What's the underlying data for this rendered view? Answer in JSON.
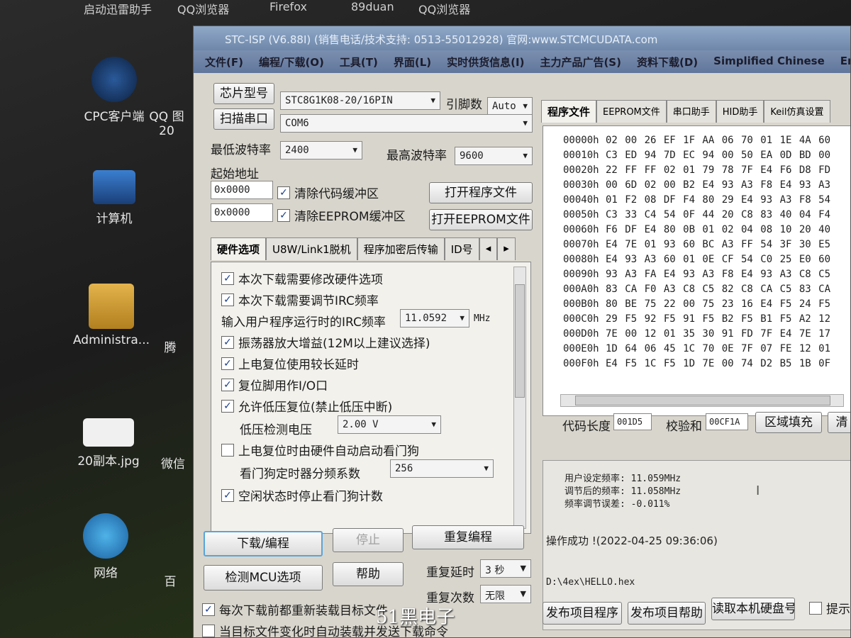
{
  "desktop": {
    "top_labels": [
      "启动迅雷助手",
      "QQ浏览器",
      "Firefox",
      "89duan",
      "QQ浏览器"
    ],
    "icons": [
      {
        "name": "cpc-client",
        "label": "CPC客户端"
      },
      {
        "name": "qq-image",
        "label": "QQ 图20"
      },
      {
        "name": "computer",
        "label": "计算机"
      },
      {
        "name": "administrator",
        "label": "Administra..."
      },
      {
        "name": "image-file",
        "label": "20副本.jpg"
      },
      {
        "name": "wechat",
        "label": "微信"
      },
      {
        "name": "network",
        "label": "网络"
      },
      {
        "name": "baidu",
        "label": "百"
      },
      {
        "name": "tencent",
        "label": "腾"
      }
    ]
  },
  "window": {
    "title": "STC-ISP (V6.88I) (销售电话/技术支持: 0513-55012928) 官网:www.STCMCUDATA.com",
    "menu": [
      "文件(F)",
      "编程/下载(O)",
      "工具(T)",
      "界面(L)",
      "实时供货信息(I)",
      "主力产品广告(S)",
      "资料下载(D)",
      "Simplified Chinese",
      "Eng"
    ]
  },
  "left": {
    "chip_button": "芯片型号",
    "chip_value": "STC8G1K08-20/16PIN",
    "pins_label": "引脚数",
    "pins_value": "Auto",
    "scan_button": "扫描串口",
    "port_value": "COM6",
    "min_baud_label": "最低波特率",
    "min_baud_value": "2400",
    "max_baud_label": "最高波特率",
    "max_baud_value": "9600",
    "start_addr_label": "起始地址",
    "code_addr": "0x0000",
    "clear_code_label": "清除代码缓冲区",
    "open_prog_button": "打开程序文件",
    "eeprom_addr": "0x0000",
    "clear_eeprom_label": "清除EEPROM缓冲区",
    "open_eeprom_button": "打开EEPROM文件",
    "tabs": [
      "硬件选项",
      "U8W/Link1脱机",
      "程序加密后传输",
      "ID号"
    ],
    "options": {
      "opt1": "本次下载需要修改硬件选项",
      "opt2": "本次下载需要调节IRC频率",
      "irc_label": "输入用户程序运行时的IRC频率",
      "irc_value": "11.0592",
      "irc_unit": "MHz",
      "opt3": "振荡器放大增益(12M以上建议选择)",
      "opt4": "上电复位使用较长延时",
      "opt5": "复位脚用作I/O口",
      "opt6": "允许低压复位(禁止低压中断)",
      "lvd_label": "低压检测电压",
      "lvd_value": "2.00 V",
      "opt7": "上电复位时由硬件自动启动看门狗",
      "wdt_label": "看门狗定时器分频系数",
      "wdt_value": "256",
      "opt8": "空闲状态时停止看门狗计数"
    },
    "download_button": "下载/编程",
    "stop_button": "停止",
    "reprogram_button": "重复编程",
    "check_mcu_button": "检测MCU选项",
    "help_button": "帮助",
    "repeat_delay_label": "重复延时",
    "repeat_delay_value": "3 秒",
    "repeat_count_label": "重复次数",
    "repeat_count_value": "无限",
    "reload_label": "每次下载前都重新装载目标文件",
    "auto_load_label": "当目标文件变化时自动装载并发送下载命令"
  },
  "right": {
    "tabs": [
      "程序文件",
      "EEPROM文件",
      "串口助手",
      "HID助手",
      "Keil仿真设置"
    ],
    "hex_rows": [
      {
        "addr": "00000h",
        "bytes": "02 00 26 EF 1F AA 06 70 01 1E 4A 60"
      },
      {
        "addr": "00010h",
        "bytes": "C3 ED 94 7D EC 94 00 50 EA 0D BD 00"
      },
      {
        "addr": "00020h",
        "bytes": "22 FF FF 02 01 79 78 7F E4 F6 D8 FD"
      },
      {
        "addr": "00030h",
        "bytes": "00 6D 02 00 B2 E4 93 A3 F8 E4 93 A3"
      },
      {
        "addr": "00040h",
        "bytes": "01 F2 08 DF F4 80 29 E4 93 A3 F8 54"
      },
      {
        "addr": "00050h",
        "bytes": "C3 33 C4 54 0F 44 20 C8 83 40 04 F4"
      },
      {
        "addr": "00060h",
        "bytes": "F6 DF E4 80 0B 01 02 04 08 10 20 40"
      },
      {
        "addr": "00070h",
        "bytes": "E4 7E 01 93 60 BC A3 FF 54 3F 30 E5"
      },
      {
        "addr": "00080h",
        "bytes": "E4 93 A3 60 01 0E CF 54 C0 25 E0 60"
      },
      {
        "addr": "00090h",
        "bytes": "93 A3 FA E4 93 A3 F8 E4 93 A3 C8 C5"
      },
      {
        "addr": "000A0h",
        "bytes": "83 CA F0 A3 C8 C5 82 C8 CA C5 83 CA"
      },
      {
        "addr": "000B0h",
        "bytes": "80 BE 75 22 00 75 23 16 E4 F5 24 F5"
      },
      {
        "addr": "000C0h",
        "bytes": "29 F5 92 F5 91 F5 B2 F5 B1 F5 A2 12"
      },
      {
        "addr": "000D0h",
        "bytes": "7E 00 12 01 35 30 91 FD 7F E4 7E 17"
      },
      {
        "addr": "000E0h",
        "bytes": "1D 64 06 45 1C 70 0E 7F 07 FE 12 01"
      },
      {
        "addr": "000F0h",
        "bytes": "E4 F5 1C F5 1D 7E 00 74 D2 B5 1B 0F"
      }
    ],
    "code_len_label": "代码长度",
    "code_len_value": "001D5",
    "checksum_label": "校验和",
    "checksum_value": "00CF1A",
    "fill_button": "区域填充",
    "clear_button": "清",
    "status_line1": "用户设定频率: 11.059MHz",
    "status_line2": "调节后的频率: 11.058MHz",
    "status_line3": "频率调节误差: -0.011%",
    "status_result": "操作成功 !(2022-04-25 09:36:06)",
    "file_path": "D:\\4ex\\HELLO.hex",
    "publish_prog_button": "发布项目程序",
    "publish_help_button": "发布项目帮助",
    "read_disk_button": "读取本机硬盘号",
    "hint_label": "提示音"
  },
  "watermark": "51黑电子"
}
